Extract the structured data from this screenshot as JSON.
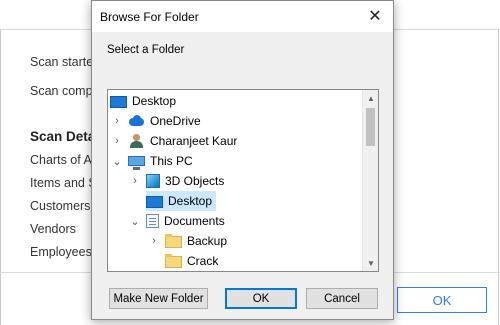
{
  "background_app": {
    "scan_started_label": "Scan started",
    "scan_completed_label": "Scan compl",
    "scan_details_heading": "Scan Deta",
    "items": [
      "Charts of Ac",
      "Items and S",
      "Customers",
      "Vendors",
      "Employees"
    ],
    "ok_label": "OK"
  },
  "dialog": {
    "title": "Browse For Folder",
    "prompt": "Select a Folder",
    "close_glyph": "✕",
    "tree": [
      {
        "label": "Desktop",
        "icon": "desktop-icon",
        "chevron": ""
      },
      {
        "label": "OneDrive",
        "icon": "onedrive-icon",
        "chevron": "›"
      },
      {
        "label": "Charanjeet Kaur",
        "icon": "user-icon",
        "chevron": "›"
      },
      {
        "label": "This PC",
        "icon": "pc-icon",
        "chevron": "⌄"
      },
      {
        "label": "3D Objects",
        "icon": "3d-objects-icon",
        "chevron": "›"
      },
      {
        "label": "Desktop",
        "icon": "desktop-icon",
        "chevron": "",
        "selected": true
      },
      {
        "label": "Documents",
        "icon": "documents-icon",
        "chevron": "⌄"
      },
      {
        "label": "Backup",
        "icon": "folder-icon",
        "chevron": "›"
      },
      {
        "label": "Crack",
        "icon": "folder-icon",
        "chevron": ""
      }
    ],
    "buttons": {
      "make_new_folder": "Make New Folder",
      "ok": "OK",
      "cancel": "Cancel"
    },
    "scroll_up_glyph": "▲",
    "scroll_down_glyph": "▼"
  }
}
